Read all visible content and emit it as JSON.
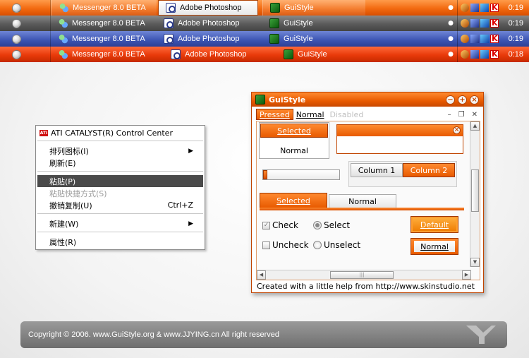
{
  "taskbars": [
    {
      "theme": "orange",
      "tasks": [
        {
          "label": "Messenger 8.0 BETA",
          "icon": "messenger-icon"
        },
        {
          "label": "Adobe Photoshop",
          "icon": "photoshop-icon"
        },
        {
          "label": "GuiStyle",
          "icon": "guistyle-icon"
        }
      ],
      "clock": "0:19"
    },
    {
      "theme": "gray",
      "tasks": [
        {
          "label": "Messenger 8.0 BETA",
          "icon": "messenger-icon"
        },
        {
          "label": "Adobe Photoshop",
          "icon": "photoshop-icon"
        },
        {
          "label": "GuiStyle",
          "icon": "guistyle-icon"
        }
      ],
      "clock": "0:19"
    },
    {
      "theme": "blue",
      "tasks": [
        {
          "label": "Messenger 8.0 BETA",
          "icon": "messenger-icon"
        },
        {
          "label": "Adobe Photoshop",
          "icon": "photoshop-icon"
        },
        {
          "label": "GuiStyle",
          "icon": "guistyle-icon"
        }
      ],
      "clock": "0:19"
    },
    {
      "theme": "red",
      "tasks": [
        {
          "label": "Messenger 8.0 BETA",
          "icon": "messenger-icon"
        },
        {
          "label": "Adobe Photoshop",
          "icon": "photoshop-icon"
        },
        {
          "label": "GuiStyle",
          "icon": "guistyle-icon"
        }
      ],
      "clock": "0:18"
    }
  ],
  "context_menu": {
    "header": "ATI CATALYST(R) Control Center",
    "items": [
      {
        "label": "排列图标(I)",
        "submenu": true
      },
      {
        "label": "刷新(E)"
      },
      {
        "label": "粘贴(P)",
        "highlighted": true
      },
      {
        "label": "粘贴快捷方式(S)",
        "disabled": true
      },
      {
        "label": "撤销复制(U)",
        "shortcut": "Ctrl+Z"
      },
      {
        "label": "新建(W)",
        "submenu": true
      },
      {
        "label": "属性(R)"
      }
    ]
  },
  "window": {
    "title": "GuiStyle",
    "menu": {
      "pressed": "Pressed",
      "normal": "Normal",
      "disabled": "Disabled"
    },
    "listbox": {
      "selected": "Selected",
      "normal": "Normal"
    },
    "progress": 0.06,
    "columns": [
      "Column 1",
      "Column 2"
    ],
    "tabs": {
      "selected": "Selected",
      "normal": "Normal"
    },
    "checks": {
      "check": "Check",
      "uncheck": "Uncheck",
      "select": "Select",
      "unselect": "Unselect"
    },
    "buttons": {
      "default": "Default",
      "normal": "Normal"
    },
    "status": "Created with a little help from http://www.skinstudio.net"
  },
  "footer": {
    "text": "Copyright © 2006.    www.GuiStyle.org & www.JJYING.cn  All right reserved"
  }
}
